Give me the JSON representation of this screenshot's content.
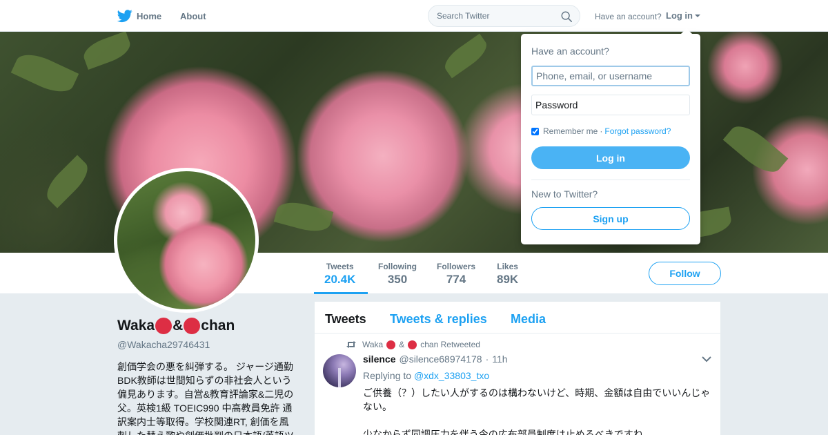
{
  "nav": {
    "home_label": "Home",
    "about_label": "About",
    "search_placeholder": "Search Twitter",
    "have_account": "Have an account?",
    "login_label": "Log in",
    "brand_color": "#1da1f2"
  },
  "profile": {
    "name_prefix": "Waka",
    "name_mid": "&",
    "name_suffix": "chan",
    "handle": "@Wakacha29746431",
    "bio": "創価学会の悪を糾弾する。 ジャージ通勤BDK教師は世間知らずの非社会人という偏見あります。自営&教育評論家&二児の父。英検1級 TOEIC990 中高教員免許 通訳案内士等取得。学校関連RT, 創価を風刺した替え歌や創価批判の日本語/英語ツ"
  },
  "stats": [
    {
      "label": "Tweets",
      "value": "20.4K"
    },
    {
      "label": "Following",
      "value": "350"
    },
    {
      "label": "Followers",
      "value": "774"
    },
    {
      "label": "Likes",
      "value": "89K"
    }
  ],
  "follow_label": "Follow",
  "timeline": {
    "tabs": [
      "Tweets",
      "Tweets & replies",
      "Media"
    ],
    "retweet_name_prefix": "Waka",
    "retweet_name_mid": "&",
    "retweet_name_suffix": "chan Retweeted",
    "tweet": {
      "name": "silence",
      "handle": "@silence68974178",
      "separator": "·",
      "time": "11h",
      "replying_label": "Replying to",
      "replying_handle": "@xdx_33803_txo",
      "text": "ご供養（？）したい人がするのは構わないけど、時期、金額は自由でいいんじゃない。",
      "text2": "少なからず同調圧力を伴う今の広布部員制度は止めるべきですね"
    }
  },
  "login_dropdown": {
    "title": "Have an account?",
    "username_placeholder": "Phone, email, or username",
    "password_placeholder": "Password",
    "remember_label": "Remember me",
    "separator": "·",
    "forgot_label": "Forgot password?",
    "login_button": "Log in",
    "new_label": "New to Twitter?",
    "signup_button": "Sign up",
    "remember_checked": true
  }
}
